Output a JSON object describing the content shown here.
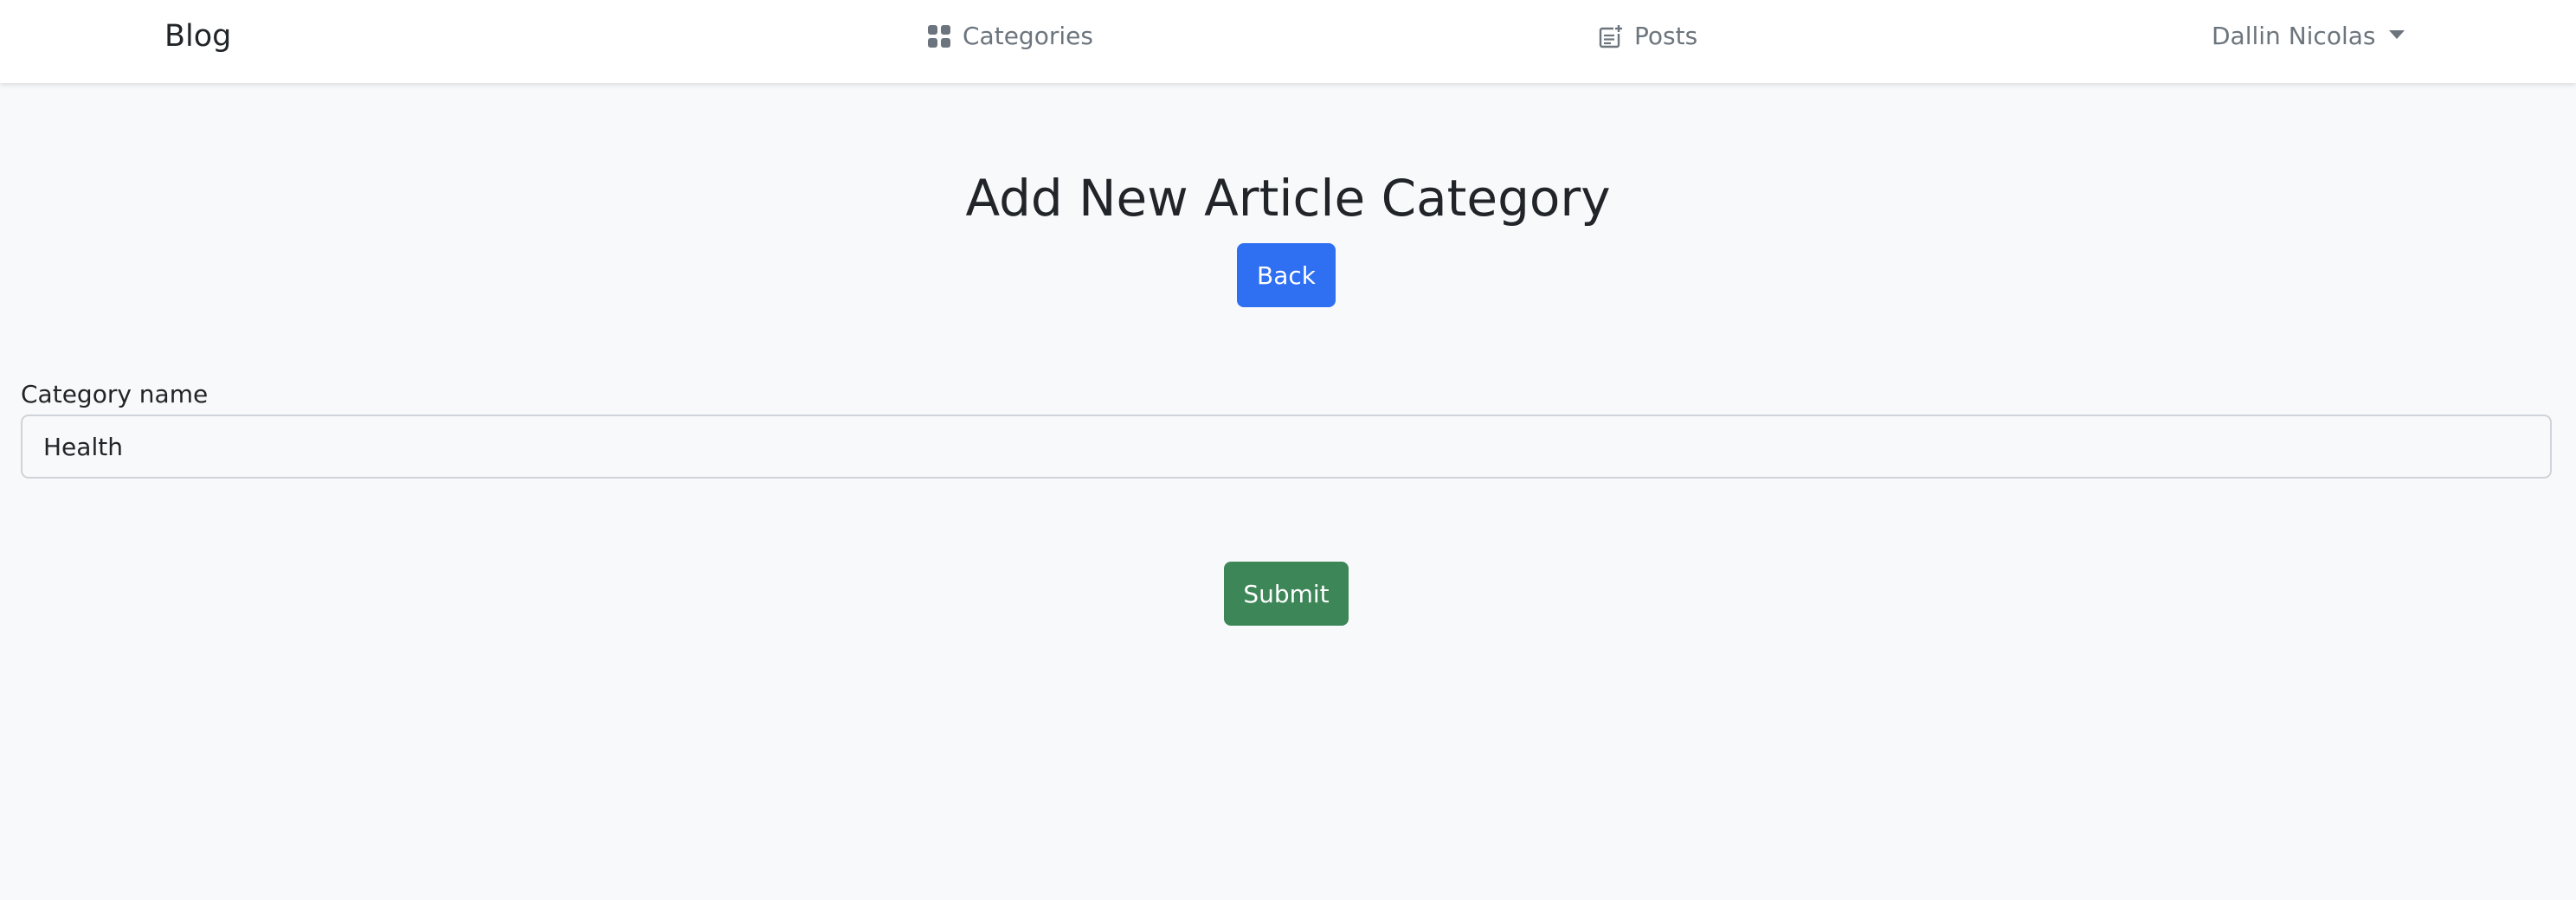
{
  "navbar": {
    "brand": "Blog",
    "categories": {
      "label": "Categories",
      "icon": "grid-icon"
    },
    "posts": {
      "label": "Posts",
      "icon": "post-add-icon"
    },
    "user": {
      "label": "Dallin Nicolas",
      "icon": "caret-down-icon"
    }
  },
  "page": {
    "title": "Add New Article Category",
    "back_label": "Back"
  },
  "form": {
    "category_label": "Category name",
    "category_value": "Health",
    "submit_label": "Submit"
  },
  "colors": {
    "background": "#f8f9fa",
    "navbar": "#ffffff",
    "primary_button": "#2f6ff2",
    "success_button": "#3d8658",
    "nav_text": "#6c757d"
  }
}
